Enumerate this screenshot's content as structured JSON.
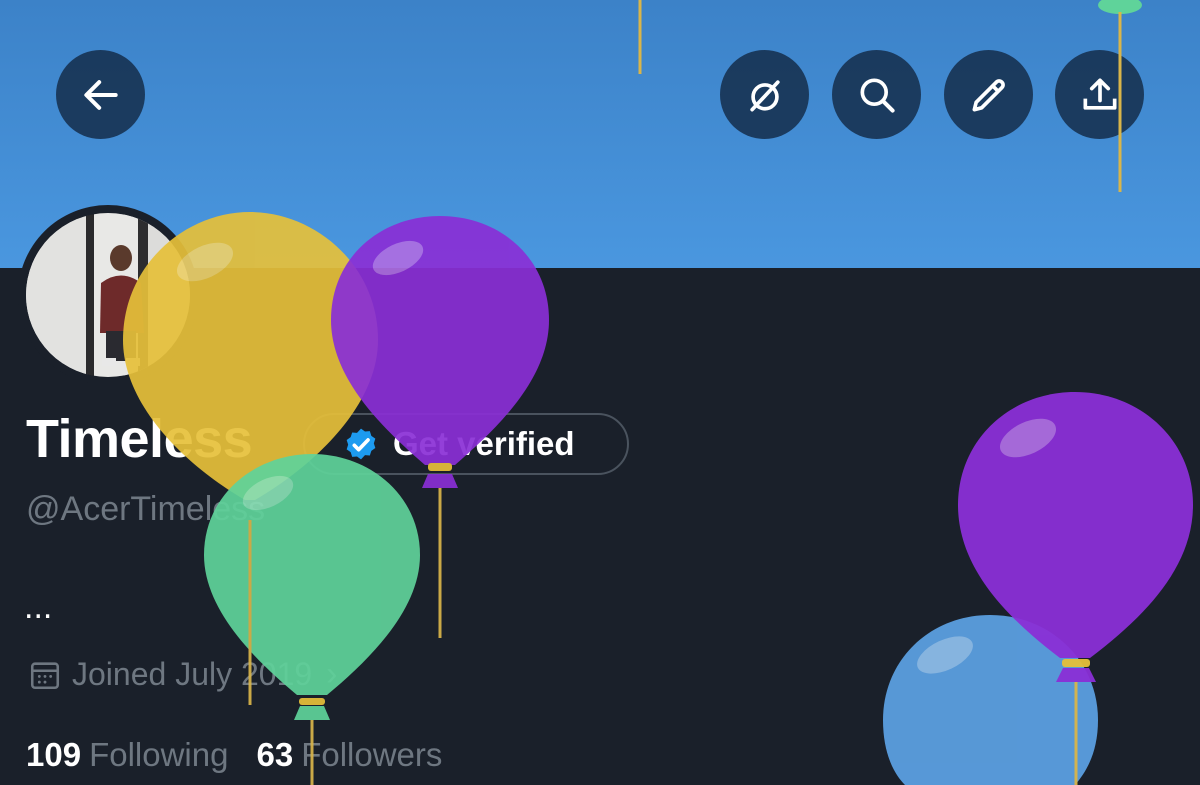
{
  "header": {
    "back_icon": "arrow-left-icon",
    "actions": [
      {
        "name": "grok-button",
        "icon": "slash-circle-icon"
      },
      {
        "name": "search-button",
        "icon": "search-icon"
      },
      {
        "name": "edit-button",
        "icon": "pencil-icon"
      },
      {
        "name": "share-button",
        "icon": "upload-icon"
      }
    ]
  },
  "profile": {
    "display_name": "Timeless",
    "handle": "@AcerTimeless",
    "verify_label": "Get verified",
    "bio": "...",
    "joined": "Joined July 2019",
    "following_count": "109",
    "following_label": "Following",
    "followers_count": "63",
    "followers_label": "Followers"
  },
  "colors": {
    "banner": "#4a97df",
    "background": "#1a202a",
    "muted_text": "#6e7781",
    "verified_badge": "#1d9bf0",
    "balloon_yellow": "#e6c03a",
    "balloon_purple": "#8a2fd6",
    "balloon_green": "#5fd39a",
    "balloon_blue": "#5b9fe0"
  }
}
